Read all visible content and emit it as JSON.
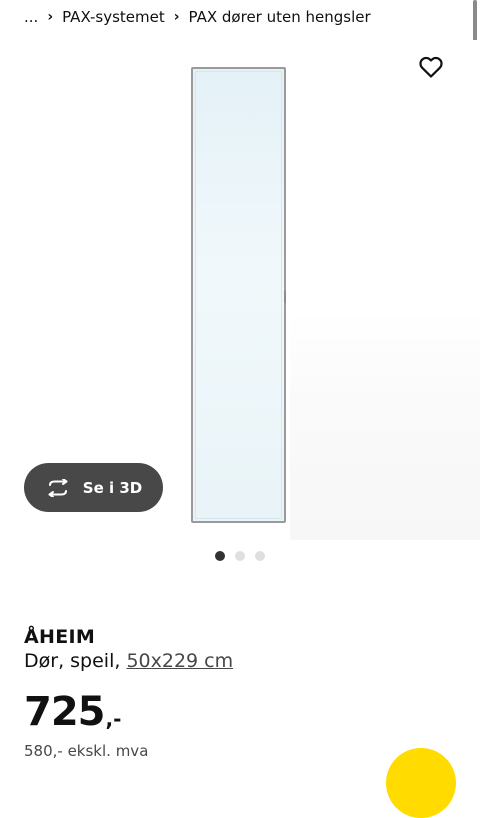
{
  "breadcrumb": {
    "ellipsis": "...",
    "separator": "›",
    "items": [
      {
        "label": "PAX-systemet"
      },
      {
        "label": "PAX dører uten hengsler"
      }
    ]
  },
  "gallery": {
    "favorite_icon": "heart-icon",
    "view_3d": {
      "label": "Se i 3D",
      "icon": "rotate-3d-icon"
    },
    "dots": [
      {
        "active": true
      },
      {
        "active": false
      },
      {
        "active": false
      }
    ]
  },
  "product": {
    "name": "ÅHEIM",
    "description_prefix": "Dør, speil, ",
    "size": "50x229 cm",
    "price": "725",
    "price_suffix": ",-",
    "price_ex_vat": "580,- ekskl. mva"
  },
  "colors": {
    "button_dark": "#484848",
    "cart_yellow": "#ffdb00",
    "mirror_tint": "#e9f4f8"
  }
}
